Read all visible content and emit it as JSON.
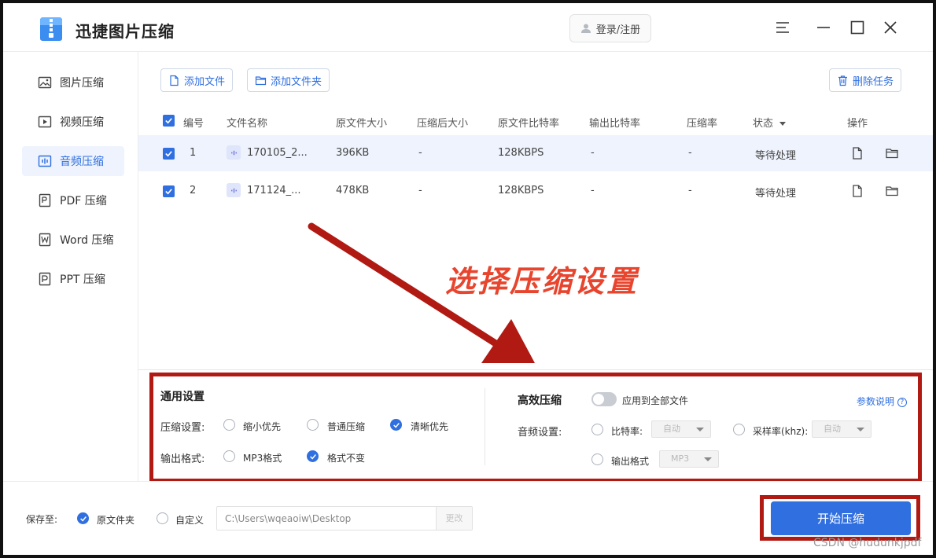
{
  "app": {
    "title": "迅捷图片压缩",
    "login_label": "登录/注册"
  },
  "sidebar": {
    "items": [
      {
        "label": "图片压缩",
        "icon": "image-icon",
        "active": false
      },
      {
        "label": "视频压缩",
        "icon": "video-icon",
        "active": false
      },
      {
        "label": "音频压缩",
        "icon": "audio-icon",
        "active": true
      },
      {
        "label": "PDF 压缩",
        "icon": "pdf-icon",
        "active": false
      },
      {
        "label": "Word 压缩",
        "icon": "word-icon",
        "active": false
      },
      {
        "label": "PPT 压缩",
        "icon": "ppt-icon",
        "active": false
      }
    ]
  },
  "toolbar": {
    "add_file": "添加文件",
    "add_folder": "添加文件夹",
    "delete_task": "删除任务"
  },
  "table": {
    "headers": [
      "编号",
      "文件名称",
      "原文件大小",
      "压缩后大小",
      "原文件比特率",
      "输出比特率",
      "压缩率",
      "状态",
      "操作"
    ],
    "rows": [
      {
        "num": "1",
        "name": "170105_2...",
        "orig_size": "396KB",
        "comp_size": "-",
        "orig_bitrate": "128KBPS",
        "out_bitrate": "-",
        "ratio": "-",
        "status": "等待处理"
      },
      {
        "num": "2",
        "name": "171124_...",
        "orig_size": "478KB",
        "comp_size": "-",
        "orig_bitrate": "128KBPS",
        "out_bitrate": "-",
        "ratio": "-",
        "status": "等待处理"
      }
    ]
  },
  "annotation": {
    "text": "选择压缩设置"
  },
  "settings": {
    "general_title": "通用设置",
    "compress_label": "压缩设置:",
    "compress_options": [
      "缩小优先",
      "普通压缩",
      "清晰优先"
    ],
    "compress_selected": "清晰优先",
    "format_label": "输出格式:",
    "format_options": [
      "MP3格式",
      "格式不变"
    ],
    "format_selected": "格式不变",
    "efficient_title": "高效压缩",
    "apply_all": "应用到全部文件",
    "param_help": "参数说明",
    "audio_label": "音频设置:",
    "bitrate_label": "比特率:",
    "bitrate_value": "自动",
    "samplerate_label": "采样率(khz):",
    "samplerate_value": "自动",
    "output_format_label": "输出格式",
    "output_format_value": "MP3"
  },
  "footer": {
    "save_to": "保存至:",
    "original_folder": "原文件夹",
    "custom": "自定义",
    "path": "C:\\Users\\wqeaoiw\\Desktop",
    "change": "更改",
    "start": "开始压缩",
    "watermark": "CSDN @hudunkjpdf"
  },
  "colors": {
    "accent": "#2f6fe0",
    "annotation_red": "#b01a12",
    "annotation_text": "#e8452e"
  }
}
